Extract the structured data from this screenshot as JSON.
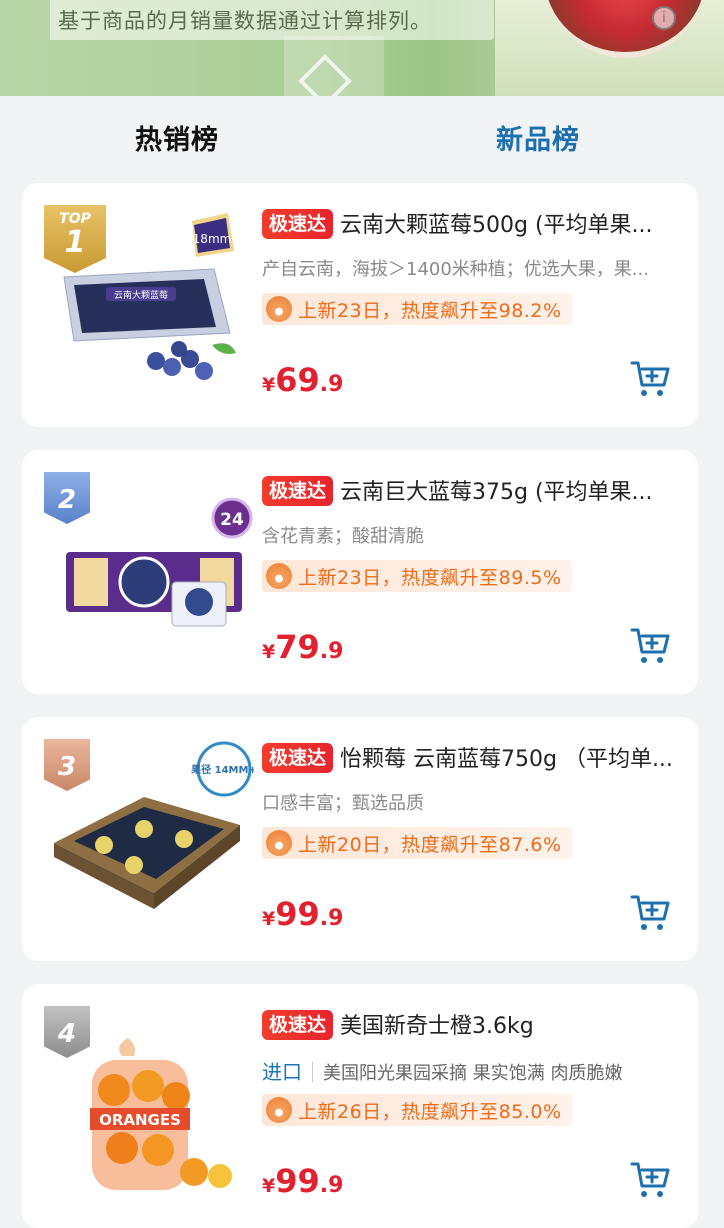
{
  "banner": {
    "text": "基于商品的月销量数据通过计算排列。"
  },
  "tabs": [
    {
      "label": "热销榜"
    },
    {
      "label": "新品榜"
    }
  ],
  "products": [
    {
      "rank_top": "TOP",
      "rank": "1",
      "tag": "极速达",
      "title": "云南大颗蓝莓500g (平均单果...",
      "desc": "产自云南，海拔＞1400米种植；优选大果，果...",
      "heat": "上新23日，热度飙升至98.2%",
      "price_int": "69",
      "price_dec": ".9",
      "img_caption": "云南大颗蓝莓",
      "img_badge": "18mm"
    },
    {
      "rank": "2",
      "tag": "极速达",
      "title": "云南巨大蓝莓375g (平均单果...",
      "desc": "含花青素；酸甜清脆",
      "heat": "上新23日，热度飙升至89.5%",
      "price_int": "79",
      "price_dec": ".9",
      "img_badge": "24"
    },
    {
      "rank": "3",
      "tag": "极速达",
      "title": "怡颗莓 云南蓝莓750g （平均单...",
      "desc": "口感丰富；甄选品质",
      "heat": "上新20日，热度飙升至87.6%",
      "price_int": "99",
      "price_dec": ".9",
      "img_badge": "果径 14MM+"
    },
    {
      "rank": "4",
      "tag": "极速达",
      "title": "美国新奇士橙3.6kg",
      "import_label": "进口",
      "desc": "美国阳光果园采摘 果实饱满 肉质脆嫩",
      "heat": "上新26日，热度飙升至85.0%",
      "price_int": "99",
      "price_dec": ".9",
      "img_caption": "ORANGES"
    }
  ],
  "currency": "¥",
  "colors": {
    "accent_red": "#e3202e",
    "tab_active_blue": "#1b6fae",
    "heat_orange": "#f06a18"
  }
}
